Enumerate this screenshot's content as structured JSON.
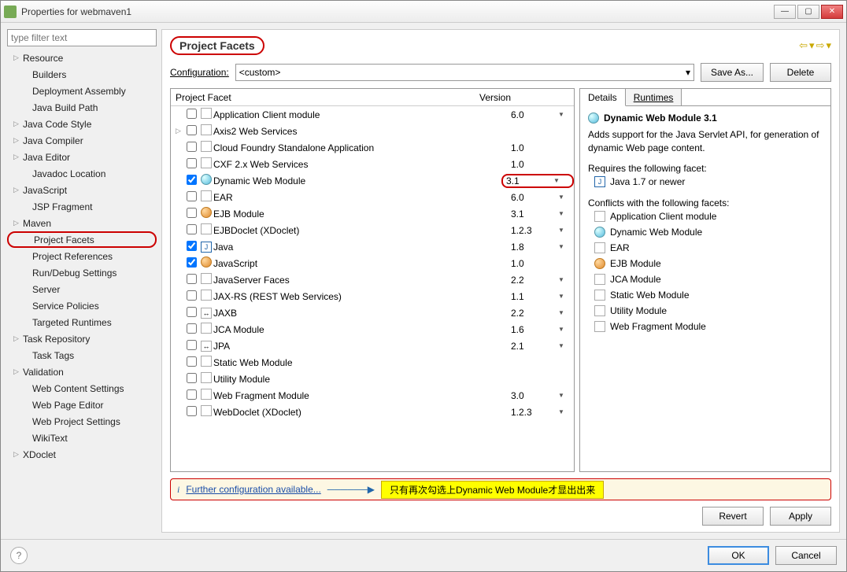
{
  "window": {
    "title": "Properties for webmaven1"
  },
  "sidebar": {
    "filter_placeholder": "type filter text",
    "items": [
      {
        "label": "Resource",
        "expandable": true,
        "indent": 0
      },
      {
        "label": "Builders",
        "indent": 1
      },
      {
        "label": "Deployment Assembly",
        "indent": 1
      },
      {
        "label": "Java Build Path",
        "indent": 1
      },
      {
        "label": "Java Code Style",
        "expandable": true,
        "indent": 0
      },
      {
        "label": "Java Compiler",
        "expandable": true,
        "indent": 0
      },
      {
        "label": "Java Editor",
        "expandable": true,
        "indent": 0
      },
      {
        "label": "Javadoc Location",
        "indent": 1
      },
      {
        "label": "JavaScript",
        "expandable": true,
        "indent": 0
      },
      {
        "label": "JSP Fragment",
        "indent": 1
      },
      {
        "label": "Maven",
        "expandable": true,
        "indent": 0
      },
      {
        "label": "Project Facets",
        "selected": true,
        "indent": 1
      },
      {
        "label": "Project References",
        "indent": 1
      },
      {
        "label": "Run/Debug Settings",
        "indent": 1
      },
      {
        "label": "Server",
        "indent": 1
      },
      {
        "label": "Service Policies",
        "indent": 1
      },
      {
        "label": "Targeted Runtimes",
        "indent": 1
      },
      {
        "label": "Task Repository",
        "expandable": true,
        "indent": 0
      },
      {
        "label": "Task Tags",
        "indent": 1
      },
      {
        "label": "Validation",
        "expandable": true,
        "indent": 0
      },
      {
        "label": "Web Content Settings",
        "indent": 1
      },
      {
        "label": "Web Page Editor",
        "indent": 1
      },
      {
        "label": "Web Project Settings",
        "indent": 1
      },
      {
        "label": "WikiText",
        "indent": 1
      },
      {
        "label": "XDoclet",
        "expandable": true,
        "indent": 0
      }
    ]
  },
  "main": {
    "title": "Project Facets",
    "config_label": "Configuration:",
    "config_value": "<custom>",
    "save_as": "Save As...",
    "delete": "Delete",
    "header_facet": "Project Facet",
    "header_version": "Version",
    "facets": [
      {
        "name": "Application Client module",
        "version": "6.0",
        "dd": true,
        "icon": "doc"
      },
      {
        "name": "Axis2 Web Services",
        "expandable": true,
        "icon": "doc"
      },
      {
        "name": "Cloud Foundry Standalone Application",
        "version": "1.0",
        "icon": "doc"
      },
      {
        "name": "CXF 2.x Web Services",
        "version": "1.0",
        "icon": "doc"
      },
      {
        "name": "Dynamic Web Module",
        "version": "3.1",
        "dd": true,
        "checked": true,
        "marked": true,
        "icon": "globe"
      },
      {
        "name": "EAR",
        "version": "6.0",
        "dd": true,
        "icon": "doc"
      },
      {
        "name": "EJB Module",
        "version": "3.1",
        "dd": true,
        "icon": "orange"
      },
      {
        "name": "EJBDoclet (XDoclet)",
        "version": "1.2.3",
        "dd": true,
        "icon": "doc"
      },
      {
        "name": "Java",
        "version": "1.8",
        "dd": true,
        "checked": true,
        "icon": "java",
        "iconText": "J"
      },
      {
        "name": "JavaScript",
        "version": "1.0",
        "checked": true,
        "icon": "orange"
      },
      {
        "name": "JavaServer Faces",
        "version": "2.2",
        "dd": true,
        "icon": "doc"
      },
      {
        "name": "JAX-RS (REST Web Services)",
        "version": "1.1",
        "dd": true,
        "icon": "doc"
      },
      {
        "name": "JAXB",
        "version": "2.2",
        "dd": true,
        "icon": "doc",
        "iconText": "↔"
      },
      {
        "name": "JCA Module",
        "version": "1.6",
        "dd": true,
        "icon": "doc"
      },
      {
        "name": "JPA",
        "version": "2.1",
        "dd": true,
        "icon": "doc",
        "iconText": "↔"
      },
      {
        "name": "Static Web Module",
        "icon": "doc"
      },
      {
        "name": "Utility Module",
        "icon": "doc"
      },
      {
        "name": "Web Fragment Module",
        "version": "3.0",
        "dd": true,
        "icon": "doc"
      },
      {
        "name": "WebDoclet (XDoclet)",
        "version": "1.2.3",
        "dd": true,
        "icon": "doc"
      }
    ],
    "further_link": "Further configuration available...",
    "annotation": "只有再次勾选上Dynamic Web Module才显出出来",
    "revert": "Revert",
    "apply": "Apply"
  },
  "details": {
    "tab_details": "Details",
    "tab_runtimes": "Runtimes",
    "title": "Dynamic Web Module 3.1",
    "desc": "Adds support for the Java Servlet API, for generation of dynamic Web page content.",
    "requires_label": "Requires the following facet:",
    "requires": [
      "Java 1.7 or newer"
    ],
    "conflicts_label": "Conflicts with the following facets:",
    "conflicts": [
      {
        "label": "Application Client module",
        "icon": "doc"
      },
      {
        "label": "Dynamic Web Module",
        "icon": "globe"
      },
      {
        "label": "EAR",
        "icon": "doc"
      },
      {
        "label": "EJB Module",
        "icon": "orange"
      },
      {
        "label": "JCA Module",
        "icon": "doc"
      },
      {
        "label": "Static Web Module",
        "icon": "doc"
      },
      {
        "label": "Utility Module",
        "icon": "doc"
      },
      {
        "label": "Web Fragment Module",
        "icon": "doc"
      }
    ]
  },
  "footer": {
    "ok": "OK",
    "cancel": "Cancel"
  }
}
